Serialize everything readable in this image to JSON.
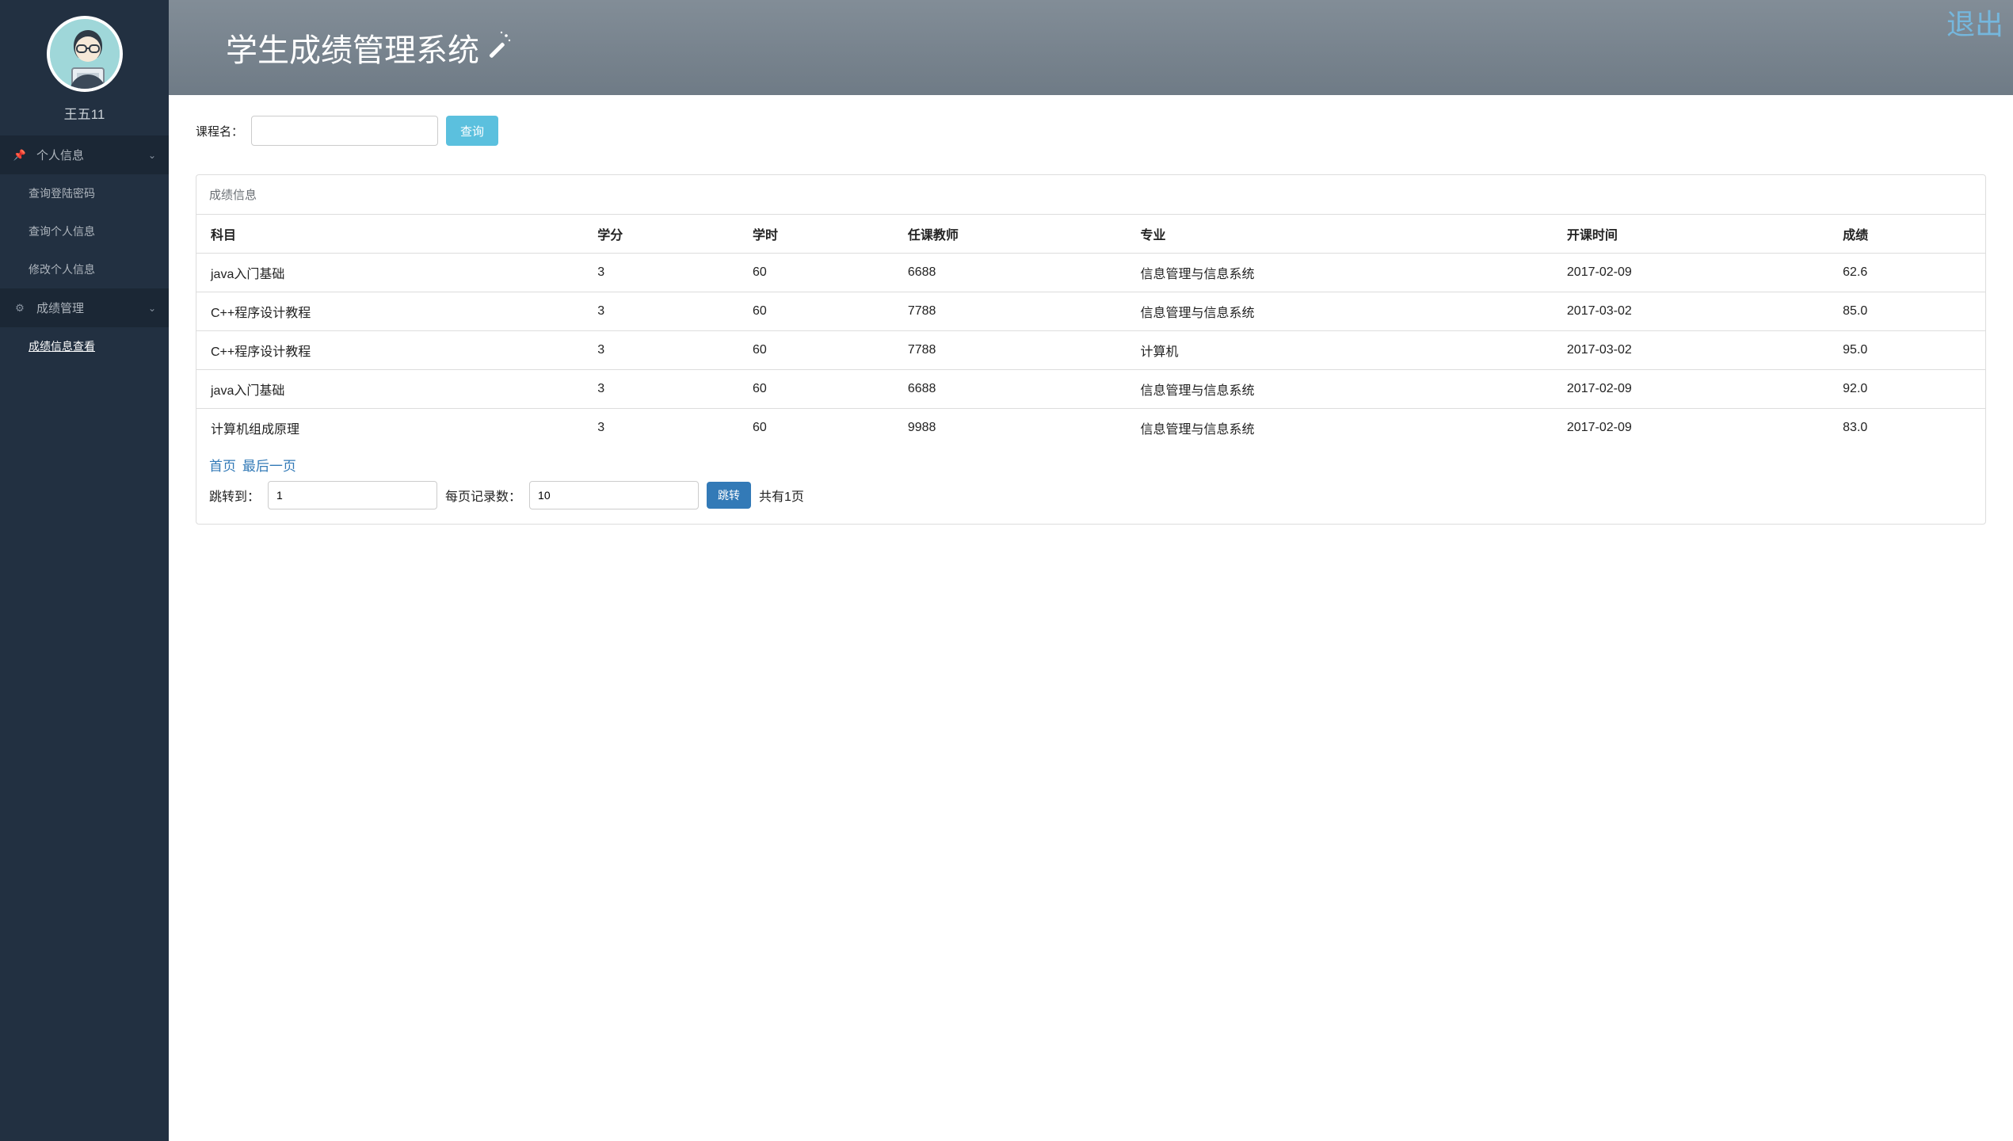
{
  "user": {
    "name": "王五11"
  },
  "header": {
    "title": "学生成绩管理系统",
    "logout": "退出"
  },
  "sidebar": {
    "group1": {
      "label": "个人信息",
      "items": [
        "查询登陆密码",
        "查询个人信息",
        "修改个人信息"
      ]
    },
    "group2": {
      "label": "成绩管理",
      "items": [
        "成绩信息查看"
      ]
    }
  },
  "search": {
    "label": "课程名：",
    "button": "查询",
    "value": ""
  },
  "panel": {
    "title": "成绩信息"
  },
  "table": {
    "headers": [
      "科目",
      "学分",
      "学时",
      "任课教师",
      "专业",
      "开课时间",
      "成绩"
    ],
    "rows": [
      [
        "java入门基础",
        "3",
        "60",
        "6688",
        "信息管理与信息系统",
        "2017-02-09",
        "62.6"
      ],
      [
        "C++程序设计教程",
        "3",
        "60",
        "7788",
        "信息管理与信息系统",
        "2017-03-02",
        "85.0"
      ],
      [
        "C++程序设计教程",
        "3",
        "60",
        "7788",
        "计算机",
        "2017-03-02",
        "95.0"
      ],
      [
        "java入门基础",
        "3",
        "60",
        "6688",
        "信息管理与信息系统",
        "2017-02-09",
        "92.0"
      ],
      [
        "计算机组成原理",
        "3",
        "60",
        "9988",
        "信息管理与信息系统",
        "2017-02-09",
        "83.0"
      ]
    ]
  },
  "pager": {
    "first": "首页",
    "last": "最后一页",
    "jump_label": "跳转到：",
    "jump_value": "1",
    "size_label": "每页记录数：",
    "size_value": "10",
    "jump_btn": "跳转",
    "total": "共有1页"
  }
}
